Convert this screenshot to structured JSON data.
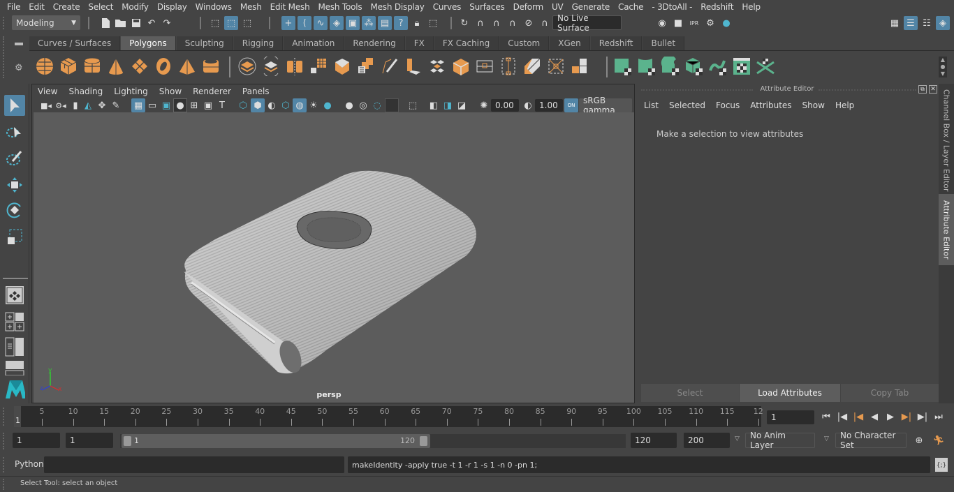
{
  "menubar": {
    "items": [
      "File",
      "Edit",
      "Create",
      "Select",
      "Modify",
      "Display",
      "Windows",
      "Mesh",
      "Edit Mesh",
      "Mesh Tools",
      "Mesh Display",
      "Curves",
      "Surfaces",
      "Deform",
      "UV",
      "Generate",
      "Cache",
      "- 3DtoAll -",
      "Redshift",
      "Help"
    ]
  },
  "statusline": {
    "mode": "Modeling",
    "live_surface": "No Live Surface"
  },
  "shelf": {
    "tabs": [
      "Curves / Surfaces",
      "Polygons",
      "Sculpting",
      "Rigging",
      "Animation",
      "Rendering",
      "FX",
      "FX Caching",
      "Custom",
      "XGen",
      "Redshift",
      "Bullet"
    ],
    "active_tab": "Polygons",
    "icons_polygons": [
      "poly-sphere-icon",
      "poly-cube-icon",
      "poly-cylinder-icon",
      "poly-cone-icon",
      "poly-plane-icon",
      "poly-torus-icon",
      "poly-pyramid-icon",
      "poly-pipe-icon"
    ],
    "icons_tools": [
      "combine-icon",
      "separate-icon",
      "mirror-icon",
      "smooth-icon",
      "bevel-icon",
      "extrude-icon",
      "multi-cut-icon",
      "bridge-icon",
      "append-icon",
      "fill-hole-icon",
      "edge-loop-icon",
      "insert-loop-icon",
      "target-weld-icon",
      "merge-icon",
      "quad-draw-icon"
    ],
    "icons_uv": [
      "planar-uv-icon",
      "cylindrical-uv-icon",
      "spherical-uv-icon",
      "automatic-uv-icon",
      "unfold-uv-icon",
      "uv-editor-icon",
      "layout-uv-icon"
    ],
    "accent_orange": "#e79a4f",
    "accent_green": "#5bb38d"
  },
  "viewport_panel": {
    "menu": [
      "View",
      "Shading",
      "Lighting",
      "Show",
      "Renderer",
      "Panels"
    ],
    "exposure": "0.00",
    "gamma": "1.00",
    "color_management": "ON",
    "colorspace": "sRGB gamma",
    "camera_label": "persp",
    "axis": {
      "x": "x",
      "y": "y",
      "z": "z"
    }
  },
  "attribute_editor": {
    "title": "Attribute Editor",
    "menu": [
      "List",
      "Selected",
      "Focus",
      "Attributes",
      "Show",
      "Help"
    ],
    "message": "Make a selection to view attributes",
    "buttons": {
      "select": "Select",
      "load": "Load Attributes",
      "copy": "Copy Tab"
    }
  },
  "side_tabs": {
    "channel_box": "Channel Box / Layer Editor",
    "attribute_editor": "Attribute Editor"
  },
  "timeslider": {
    "start_label": "1",
    "ticks": [
      "5",
      "10",
      "15",
      "20",
      "25",
      "30",
      "35",
      "40",
      "45",
      "50",
      "55",
      "60",
      "65",
      "70",
      "75",
      "80",
      "85",
      "90",
      "95",
      "100",
      "105",
      "110",
      "115",
      "12"
    ],
    "current_frame": "1"
  },
  "range": {
    "start": "1",
    "playback_start": "1",
    "range_min_label": "1",
    "range_max_label": "120",
    "playback_end": "120",
    "end": "200",
    "anim_layer": "No Anim Layer",
    "character_set": "No Character Set"
  },
  "cmdline": {
    "language": "Python",
    "input": "",
    "result": "makeIdentity -apply true -t 1 -r 1 -s 1 -n 0 -pn 1;"
  },
  "helpline": {
    "text": "Select Tool: select an object"
  }
}
